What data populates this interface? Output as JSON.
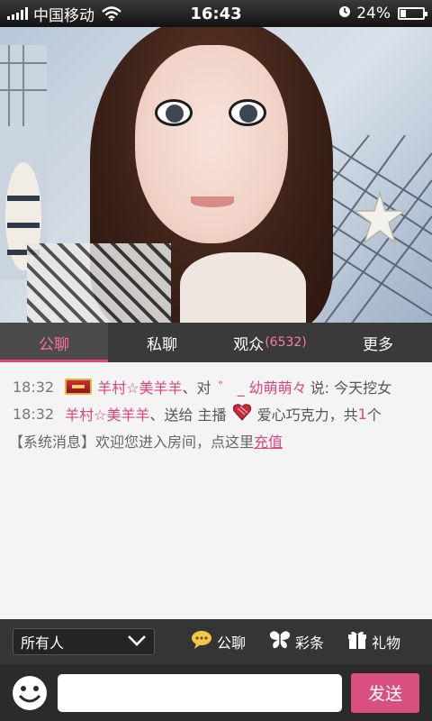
{
  "status_bar": {
    "carrier": "中国移动",
    "time": "16:43",
    "battery": "24%",
    "battery_level": 0.24
  },
  "tabs": [
    {
      "label": "公聊",
      "active": true
    },
    {
      "label": "私聊"
    },
    {
      "label": "观众",
      "count": "(6532)"
    },
    {
      "label": "更多"
    }
  ],
  "chat": {
    "messages": [
      {
        "time": "18:32",
        "user": "羊村☆美羊羊",
        "mid": "、对",
        "target": "゛ _ 幼萌萌々",
        "text": "说: 今天挖女"
      },
      {
        "time": "18:32",
        "user": "羊村☆美羊羊",
        "action": "、送给 主播",
        "gift": "爱心巧克力，共",
        "qty": "1",
        "unit": "个"
      }
    ],
    "system": {
      "text": "【系统消息】欢迎您进入房间，点这里",
      "link": "充值"
    }
  },
  "toolbar": {
    "recipient": "所有人",
    "public_chat": "公聊",
    "ribbon": "彩条",
    "gift": "礼物"
  },
  "input": {
    "placeholder": "",
    "send_label": "发送"
  },
  "colors": {
    "accent": "#e0457f",
    "tab_bar": "#3a3a3a",
    "send_button": "#d94f7f"
  }
}
